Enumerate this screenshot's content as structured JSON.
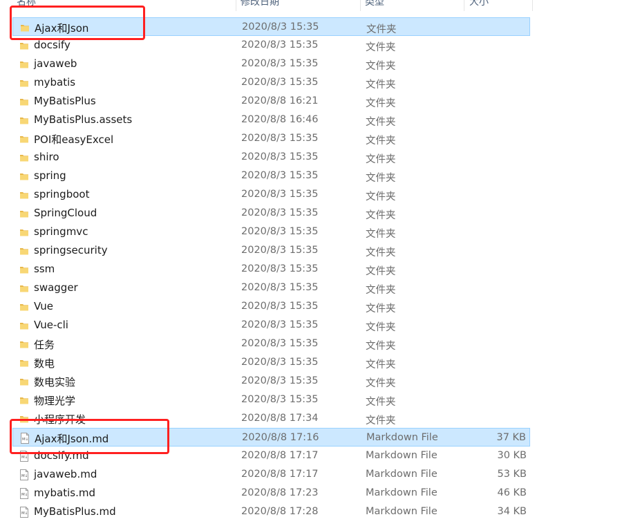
{
  "columns": {
    "name": "名称",
    "date": "修改日期",
    "type": "类型",
    "size": "大小"
  },
  "rows": [
    {
      "name": "Ajax和Json",
      "date": "2020/8/3 15:35",
      "type": "文件夹",
      "size": "",
      "kind": "folder",
      "selected": true
    },
    {
      "name": "docsify",
      "date": "2020/8/3 15:35",
      "type": "文件夹",
      "size": "",
      "kind": "folder"
    },
    {
      "name": "javaweb",
      "date": "2020/8/3 15:35",
      "type": "文件夹",
      "size": "",
      "kind": "folder"
    },
    {
      "name": "mybatis",
      "date": "2020/8/3 15:35",
      "type": "文件夹",
      "size": "",
      "kind": "folder"
    },
    {
      "name": "MyBatisPlus",
      "date": "2020/8/8 16:21",
      "type": "文件夹",
      "size": "",
      "kind": "folder"
    },
    {
      "name": "MyBatisPlus.assets",
      "date": "2020/8/8 16:46",
      "type": "文件夹",
      "size": "",
      "kind": "folder"
    },
    {
      "name": "POI和easyExcel",
      "date": "2020/8/3 15:35",
      "type": "文件夹",
      "size": "",
      "kind": "folder"
    },
    {
      "name": "shiro",
      "date": "2020/8/3 15:35",
      "type": "文件夹",
      "size": "",
      "kind": "folder"
    },
    {
      "name": "spring",
      "date": "2020/8/3 15:35",
      "type": "文件夹",
      "size": "",
      "kind": "folder"
    },
    {
      "name": "springboot",
      "date": "2020/8/3 15:35",
      "type": "文件夹",
      "size": "",
      "kind": "folder"
    },
    {
      "name": "SpringCloud",
      "date": "2020/8/3 15:35",
      "type": "文件夹",
      "size": "",
      "kind": "folder"
    },
    {
      "name": "springmvc",
      "date": "2020/8/3 15:35",
      "type": "文件夹",
      "size": "",
      "kind": "folder"
    },
    {
      "name": "springsecurity",
      "date": "2020/8/3 15:35",
      "type": "文件夹",
      "size": "",
      "kind": "folder"
    },
    {
      "name": "ssm",
      "date": "2020/8/3 15:35",
      "type": "文件夹",
      "size": "",
      "kind": "folder"
    },
    {
      "name": "swagger",
      "date": "2020/8/3 15:35",
      "type": "文件夹",
      "size": "",
      "kind": "folder"
    },
    {
      "name": "Vue",
      "date": "2020/8/3 15:35",
      "type": "文件夹",
      "size": "",
      "kind": "folder"
    },
    {
      "name": "Vue-cli",
      "date": "2020/8/3 15:35",
      "type": "文件夹",
      "size": "",
      "kind": "folder"
    },
    {
      "name": "任务",
      "date": "2020/8/3 15:35",
      "type": "文件夹",
      "size": "",
      "kind": "folder"
    },
    {
      "name": "数电",
      "date": "2020/8/3 15:35",
      "type": "文件夹",
      "size": "",
      "kind": "folder"
    },
    {
      "name": "数电实验",
      "date": "2020/8/3 15:35",
      "type": "文件夹",
      "size": "",
      "kind": "folder"
    },
    {
      "name": "物理光学",
      "date": "2020/8/3 15:35",
      "type": "文件夹",
      "size": "",
      "kind": "folder"
    },
    {
      "name": "小程序开发",
      "date": "2020/8/8 17:34",
      "type": "文件夹",
      "size": "",
      "kind": "folder"
    },
    {
      "name": "Ajax和Json.md",
      "date": "2020/8/8 17:16",
      "type": "Markdown File",
      "size": "37 KB",
      "kind": "md",
      "selected": true
    },
    {
      "name": "docsify.md",
      "date": "2020/8/8 17:17",
      "type": "Markdown File",
      "size": "30 KB",
      "kind": "md"
    },
    {
      "name": "javaweb.md",
      "date": "2020/8/8 17:17",
      "type": "Markdown File",
      "size": "53 KB",
      "kind": "md"
    },
    {
      "name": "mybatis.md",
      "date": "2020/8/8 17:23",
      "type": "Markdown File",
      "size": "46 KB",
      "kind": "md"
    },
    {
      "name": "MyBatisPlus.md",
      "date": "2020/8/8 17:28",
      "type": "Markdown File",
      "size": "34 KB",
      "kind": "md"
    }
  ],
  "colors": {
    "selection_bg": "#cce8ff",
    "selection_border": "#99d1ff",
    "annotation": "#ff2020",
    "folder": "#f8d775"
  },
  "icons": {
    "folder": "folder-icon",
    "md": "markdown-file-icon"
  }
}
